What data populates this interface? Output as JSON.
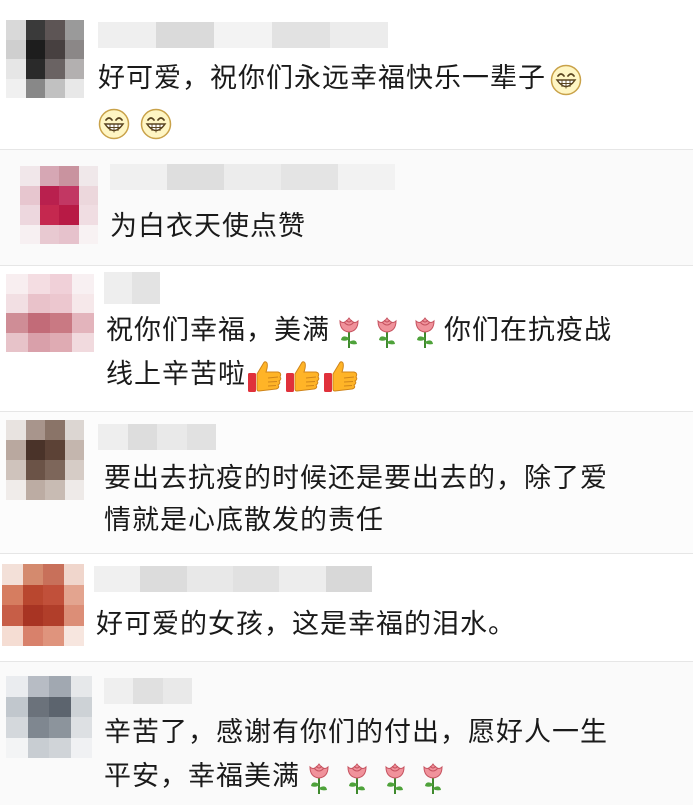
{
  "comments": [
    {
      "text_lines": [
        "好可爱，祝你们永远幸福快乐一辈子"
      ],
      "avatar_colors": [
        "#d9d9d9",
        "#3a3a3a",
        "#5d5555",
        "#9a9a9a",
        "#cfcfcf",
        "#1d1d1d",
        "#474040",
        "#8b8787",
        "#e6e6e6",
        "#2a2a2a",
        "#6a6363",
        "#b3b0b0",
        "#f0f0f0",
        "#888",
        "#c1c1c1",
        "#e8e8e8"
      ],
      "name_colors": [
        "#efefef",
        "#dadada",
        "#f3f3f3",
        "#e2e2e2",
        "#ececec"
      ]
    },
    {
      "text_lines": [
        "为白衣天使点赞"
      ],
      "avatar_colors": [
        "#f1e7ea",
        "#d6a7b4",
        "#c9939f",
        "#f0e8ea",
        "#e7c6cf",
        "#b9204e",
        "#c23763",
        "#ecd7dc",
        "#edd7de",
        "#c5284f",
        "#b81a45",
        "#f0dde2",
        "#f7f0f2",
        "#e8c9d1",
        "#e6c2cc",
        "#f8f2f3"
      ],
      "name_colors": [
        "#f0f0f0",
        "#dedede",
        "#ececec",
        "#e4e4e4",
        "#f2f2f2"
      ]
    },
    {
      "text_lines": [
        "祝你们幸福，美满",
        "你们在抗疫战",
        "线上辛苦啦"
      ],
      "avatar_colors": [
        "#f8eef0",
        "#f4dde2",
        "#f0d0d8",
        "#f8f0f2",
        "#f2dfe3",
        "#e9c2ca",
        "#ecc7cf",
        "#f6e8ea",
        "#cf8d96",
        "#c26b78",
        "#c97983",
        "#e3b4bc",
        "#e7c3c9",
        "#d9a0aa",
        "#dfabb3",
        "#f1dade"
      ],
      "name_colors": [
        "#eeeeee",
        "#e3e3e3"
      ]
    },
    {
      "text_lines": [
        "要出去抗疫的时候还是要出去的，除了爱",
        "情就是心底散发的责任"
      ],
      "avatar_colors": [
        "#e8e3e0",
        "#a8958c",
        "#8a7468",
        "#dcd6d2",
        "#b9a89f",
        "#4a3329",
        "#5c4236",
        "#c4b6ae",
        "#cfc3bc",
        "#6b5347",
        "#7d665a",
        "#d6ccc6",
        "#f0ecea",
        "#bcaca3",
        "#c8bbb3",
        "#eeeae8"
      ],
      "name_colors": [
        "#eeeeee",
        "#dddddd",
        "#e9e9e9",
        "#e1e1e1"
      ]
    },
    {
      "text_lines": [
        "好可爱的女孩，这是幸福的泪水。"
      ],
      "avatar_colors": [
        "#f3e0d8",
        "#d48a6e",
        "#c8705a",
        "#f0d6cc",
        "#d67d60",
        "#b9472f",
        "#c1503a",
        "#e3a48f",
        "#c75e47",
        "#a83423",
        "#b13e2a",
        "#dc8e77",
        "#f5ddd3",
        "#d8816b",
        "#df947d",
        "#f7e6df"
      ],
      "name_colors": [
        "#f0f0f0",
        "#dcdcdc",
        "#e8e8e8",
        "#e1e1e1",
        "#ededed",
        "#d8d8d8"
      ]
    },
    {
      "text_lines": [
        "辛苦了，感谢有你们的付出，愿好人一生",
        "平安，幸福美满"
      ],
      "avatar_colors": [
        "#eaecef",
        "#b7bcc4",
        "#a1a8b1",
        "#e6e8ea",
        "#c1c7cd",
        "#6b727b",
        "#5c646e",
        "#cdd2d6",
        "#d4d8dc",
        "#7f8790",
        "#8c949c",
        "#dde0e3",
        "#f3f4f5",
        "#c8cdd2",
        "#d0d4d8",
        "#f0f1f3"
      ],
      "name_colors": [
        "#efefef",
        "#e0e0e0",
        "#e9e9e9"
      ]
    }
  ],
  "icons": {
    "grin": "grinning-face-emoji",
    "rose": "rose-emoji",
    "thumb": "thumbs-up-emoji"
  }
}
